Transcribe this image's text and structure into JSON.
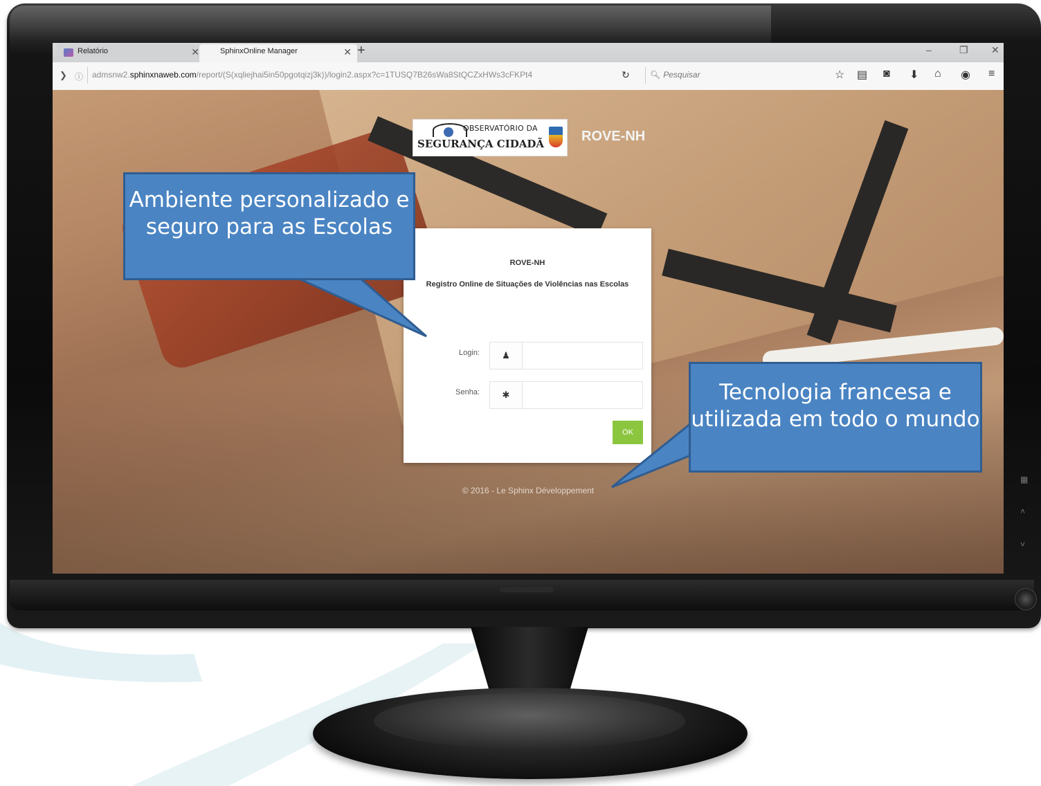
{
  "browser": {
    "tabs": [
      {
        "label": "Relatório"
      },
      {
        "label": "SphinxOnline Manager"
      }
    ],
    "url": {
      "prefix": "admsnw2.",
      "domain": "sphinxnaweb.com",
      "path": "/report/(S(xqliejhai5in50pgotqizj3k))/login2.aspx?c=1TUSQ7B26sWa8StQCZxHWs3cFKPt4"
    },
    "search_placeholder": "Pesquisar"
  },
  "page": {
    "logo": {
      "line1": "OBSERVATÓRIO DA",
      "line2": "SEGURANÇA CIDADÃ"
    },
    "site_title": "ROVE-NH",
    "login": {
      "title": "ROVE-NH",
      "subtitle": "Registro Online de Situações de Violências nas Escolas",
      "login_label": "Login:",
      "password_label": "Senha:",
      "login_value": "",
      "password_value": "",
      "ok_label": "OK"
    },
    "footer": "© 2016 - Le Sphinx Développement"
  },
  "callouts": {
    "left": "Ambiente personalizado e seguro para as Escolas",
    "right": "Tecnologia francesa e utilizada em todo o mundo"
  },
  "icons": {
    "user": "user-icon",
    "asterisk": "asterisk-icon",
    "star": "bookmark-star-icon",
    "reading_list": "reading-list-icon",
    "pocket": "pocket-icon",
    "download": "download-icon",
    "home": "home-icon",
    "chat": "chat-icon",
    "menu": "hamburger-menu-icon"
  },
  "colors": {
    "callout_fill": "#4a84c3",
    "callout_border": "#2f5d91",
    "ok_button": "#8cc63f"
  }
}
